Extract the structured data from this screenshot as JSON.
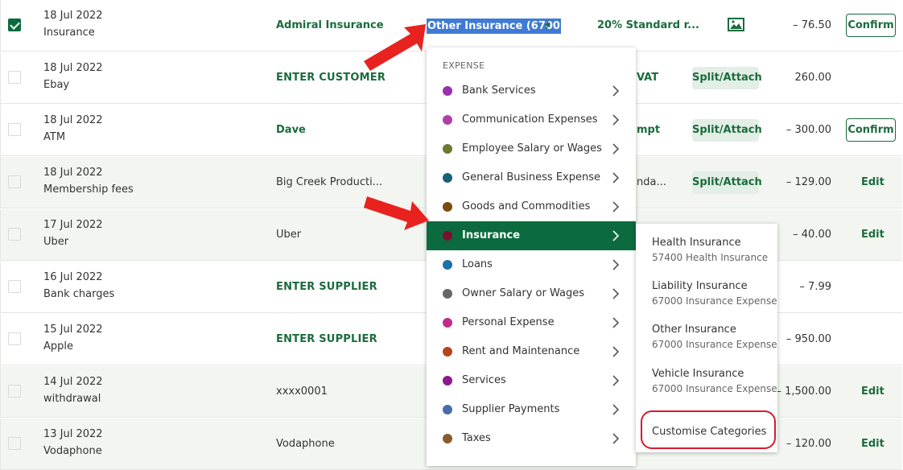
{
  "rows": [
    {
      "date": "18 Jul 2022",
      "desc": "Insurance",
      "payee": "Admiral Insurance",
      "amount": "– 76.50",
      "action": "Confirm",
      "checked": true
    },
    {
      "date": "18 Jul 2022",
      "desc": "Ebay",
      "payee": "ENTER CUSTOMER",
      "tax": "VAT",
      "split": "Split/Attach",
      "amount": "260.00"
    },
    {
      "date": "18 Jul 2022",
      "desc": "ATM",
      "payee": "Dave",
      "tax": "mpt",
      "split": "Split/Attach",
      "amount": "– 300.00",
      "action": "Confirm"
    },
    {
      "date": "18 Jul 2022",
      "desc": "Membership fees",
      "payee": "Big Creek Producti...",
      "tax": "nda...",
      "split": "Split/Attach",
      "amount": "– 129.00",
      "action": "Edit"
    },
    {
      "date": "17 Jul 2022",
      "desc": "Uber",
      "payee": "Uber",
      "amount": "– 40.00",
      "action": "Edit"
    },
    {
      "date": "16 Jul 2022",
      "desc": "Bank charges",
      "payee": "ENTER SUPPLIER",
      "amount": "– 7.99"
    },
    {
      "date": "15 Jul 2022",
      "desc": "Apple",
      "payee": "ENTER SUPPLIER",
      "amount": "– 950.00"
    },
    {
      "date": "14 Jul 2022",
      "desc": "withdrawal",
      "payee": "xxxx0001",
      "amount": "– 1,500.00",
      "action": "Edit"
    },
    {
      "date": "13 Jul 2022",
      "desc": "Vodaphone",
      "payee": "Vodaphone",
      "amount": "– 120.00",
      "action": "Edit"
    }
  ],
  "row0": {
    "category_selected": "Other Insurance (6700",
    "tax_rate": "20% Standard r..."
  },
  "dropdown": {
    "heading": "EXPENSE",
    "items": [
      {
        "label": "Bank Services",
        "color": "#9b2fae"
      },
      {
        "label": "Communication Expenses",
        "color": "#b040a8"
      },
      {
        "label": "Employee Salary or Wages",
        "color": "#6b7a33"
      },
      {
        "label": "General Business Expense",
        "color": "#1a5f7a"
      },
      {
        "label": "Goods and Commodities",
        "color": "#7a4a10"
      },
      {
        "label": "Insurance",
        "color": "#7a1030"
      },
      {
        "label": "Loans",
        "color": "#1f6fa8"
      },
      {
        "label": "Owner Salary or Wages",
        "color": "#666666"
      },
      {
        "label": "Personal Expense",
        "color": "#c42a8a"
      },
      {
        "label": "Rent and Maintenance",
        "color": "#b5461c"
      },
      {
        "label": "Services",
        "color": "#8a1a8a"
      },
      {
        "label": "Supplier Payments",
        "color": "#4a6aa8"
      },
      {
        "label": "Taxes",
        "color": "#8a5a2a"
      }
    ]
  },
  "submenu": {
    "items": [
      {
        "title": "Health Insurance",
        "sub": "57400 Health Insurance"
      },
      {
        "title": "Liability Insurance",
        "sub": "67000 Insurance Expense"
      },
      {
        "title": "Other Insurance",
        "sub": "67000 Insurance Expense"
      },
      {
        "title": "Vehicle Insurance",
        "sub": "67000 Insurance Expense"
      }
    ],
    "customise": "Customise Categories"
  },
  "colors": {
    "brand_green": "#0c6b3e",
    "highlight_ring": "#d81a30",
    "arrow": "#e8221f"
  },
  "icons": [
    "image-icon",
    "bolt-icon",
    "chevron-right-icon",
    "checkbox-checked-icon",
    "arrow-annotation-icon"
  ]
}
